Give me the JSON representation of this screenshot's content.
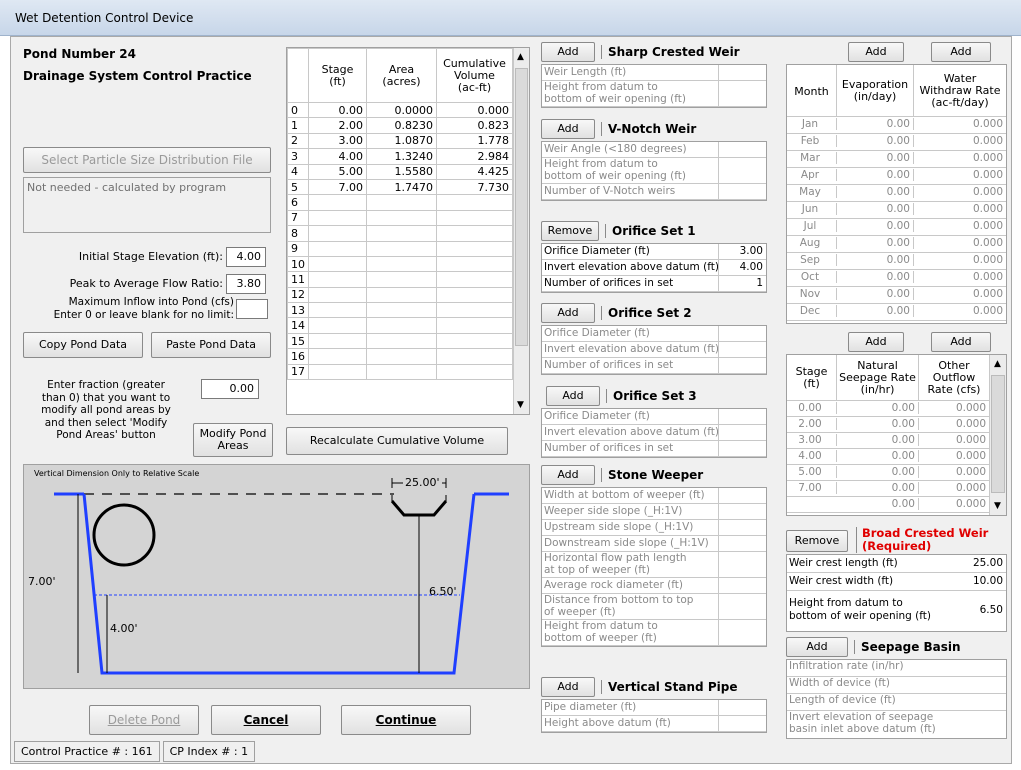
{
  "window": {
    "title": "Wet Detention Control Device"
  },
  "left": {
    "pond_number": "Pond Number 24",
    "practice": "Drainage System Control Practice",
    "select_psd_label": "Select Particle Size Distribution File",
    "psd_note": "Not needed - calculated by program",
    "initial_stage_label": "Initial Stage Elevation (ft):",
    "initial_stage_value": "4.00",
    "peak_ratio_label": "Peak to Average Flow Ratio:",
    "peak_ratio_value": "3.80",
    "max_inflow_label_1": "Maximum Inflow into Pond (cfs)",
    "max_inflow_label_2": "Enter 0 or leave blank for no limit:",
    "max_inflow_value": "",
    "copy_label": "Copy Pond Data",
    "paste_label": "Paste Pond Data",
    "fraction_label_1": "Enter fraction (greater",
    "fraction_label_2": "than 0) that you want to",
    "fraction_label_3": "modify all pond areas by",
    "fraction_label_4": "and then select 'Modify",
    "fraction_label_5": "Pond Areas' button",
    "fraction_value": "0.00",
    "modify_label": "Modify Pond Areas"
  },
  "stage_table": {
    "headers": [
      "Stage\n(ft)",
      "Area\n(acres)",
      "Cumulative\nVolume\n(ac-ft)"
    ],
    "rows": [
      [
        "0",
        "0.00",
        "0.0000",
        "0.000"
      ],
      [
        "1",
        "2.00",
        "0.8230",
        "0.823"
      ],
      [
        "2",
        "3.00",
        "1.0870",
        "1.778"
      ],
      [
        "3",
        "4.00",
        "1.3240",
        "2.984"
      ],
      [
        "4",
        "5.00",
        "1.5580",
        "4.425"
      ],
      [
        "5",
        "7.00",
        "1.7470",
        "7.730"
      ],
      [
        "6",
        "",
        "",
        ""
      ],
      [
        "7",
        "",
        "",
        ""
      ],
      [
        "8",
        "",
        "",
        ""
      ],
      [
        "9",
        "",
        "",
        ""
      ],
      [
        "10",
        "",
        "",
        ""
      ],
      [
        "11",
        "",
        "",
        ""
      ],
      [
        "12",
        "",
        "",
        ""
      ],
      [
        "13",
        "",
        "",
        ""
      ],
      [
        "14",
        "",
        "",
        ""
      ],
      [
        "15",
        "",
        "",
        ""
      ],
      [
        "16",
        "",
        "",
        ""
      ],
      [
        "17",
        "",
        "",
        ""
      ]
    ],
    "recalc_label": "Recalculate Cumulative Volume"
  },
  "diagram": {
    "caption": "Vertical Dimension Only to Relative Scale",
    "top_width": "25.00'",
    "depth": "7.00'",
    "weir_height": "6.50'",
    "initial": "4.00'"
  },
  "buttons": {
    "delete": "Delete Pond",
    "cancel": "Cancel",
    "continue": "Continue"
  },
  "status": {
    "cp": "Control Practice # :  161",
    "idx": "CP Index # :  1"
  },
  "devices": {
    "sharp": {
      "btn": "Add",
      "title": "Sharp Crested Weir",
      "rows": [
        "Weir Length (ft)",
        "Height from datum to\nbottom of weir opening (ft)"
      ]
    },
    "vnotch": {
      "btn": "Add",
      "title": "V-Notch Weir",
      "rows": [
        "Weir Angle (<180 degrees)",
        "Height from datum to\nbottom of weir opening (ft)",
        "Number of V-Notch weirs"
      ]
    },
    "orifice1": {
      "btn": "Remove",
      "title": "Orifice Set 1",
      "rows": [
        "Orifice Diameter (ft)",
        "Invert elevation above datum (ft)",
        "Number of orifices in set"
      ],
      "values": [
        "3.00",
        "4.00",
        "1"
      ]
    },
    "orifice2": {
      "btn": "Add",
      "title": "Orifice Set 2",
      "rows": [
        "Orifice Diameter (ft)",
        "Invert elevation above datum (ft)",
        "Number of orifices in set"
      ]
    },
    "orifice3": {
      "btn": "Add",
      "title": "Orifice Set 3",
      "rows": [
        "Orifice Diameter (ft)",
        "Invert elevation above datum (ft)",
        "Number of orifices in set"
      ]
    },
    "stone": {
      "btn": "Add",
      "title": "Stone Weeper",
      "rows": [
        "Width at bottom of weeper (ft)",
        "Weeper side slope (_H:1V)",
        "Upstream side slope (_H:1V)",
        "Downstream side slope (_H:1V)",
        "Horizontal flow path length\nat top of weeper (ft)",
        "Average rock diameter (ft)",
        "Distance from bottom to top\nof weeper (ft)",
        "Height from datum to\nbottom of weeper (ft)"
      ]
    },
    "standpipe": {
      "btn": "Add",
      "title": "Vertical Stand Pipe",
      "rows": [
        "Pipe diameter (ft)",
        "Height above datum (ft)"
      ]
    }
  },
  "monthly": {
    "add1": "Add",
    "add2": "Add",
    "headers": [
      "Month",
      "Evaporation\n(in/day)",
      "Water\nWithdraw Rate\n(ac-ft/day)"
    ],
    "rows": [
      [
        "Jan",
        "0.00",
        "0.000"
      ],
      [
        "Feb",
        "0.00",
        "0.000"
      ],
      [
        "Mar",
        "0.00",
        "0.000"
      ],
      [
        "Apr",
        "0.00",
        "0.000"
      ],
      [
        "May",
        "0.00",
        "0.000"
      ],
      [
        "Jun",
        "0.00",
        "0.000"
      ],
      [
        "Jul",
        "0.00",
        "0.000"
      ],
      [
        "Aug",
        "0.00",
        "0.000"
      ],
      [
        "Sep",
        "0.00",
        "0.000"
      ],
      [
        "Oct",
        "0.00",
        "0.000"
      ],
      [
        "Nov",
        "0.00",
        "0.000"
      ],
      [
        "Dec",
        "0.00",
        "0.000"
      ]
    ]
  },
  "seepage": {
    "add1": "Add",
    "add2": "Add",
    "headers": [
      "Stage\n(ft)",
      "Natural\nSeepage Rate\n(in/hr)",
      "Other\nOutflow\nRate (cfs)"
    ],
    "rows": [
      [
        "0.00",
        "0.00",
        "0.000"
      ],
      [
        "2.00",
        "0.00",
        "0.000"
      ],
      [
        "3.00",
        "0.00",
        "0.000"
      ],
      [
        "4.00",
        "0.00",
        "0.000"
      ],
      [
        "5.00",
        "0.00",
        "0.000"
      ],
      [
        "7.00",
        "0.00",
        "0.000"
      ],
      [
        "",
        "0.00",
        "0.000"
      ]
    ]
  },
  "broad": {
    "btn": "Remove",
    "title1": "Broad Crested Weir",
    "title2": "(Required)",
    "rows": [
      "Weir crest length (ft)",
      "Weir crest width (ft)",
      "Height from datum to\nbottom of weir opening (ft)"
    ],
    "values": [
      "25.00",
      "10.00",
      "6.50"
    ]
  },
  "basin": {
    "btn": "Add",
    "title": "Seepage Basin",
    "rows": [
      "Infiltration rate (in/hr)",
      "Width of device (ft)",
      "Length of device (ft)",
      "Invert elevation of seepage\nbasin inlet above datum (ft)"
    ]
  }
}
